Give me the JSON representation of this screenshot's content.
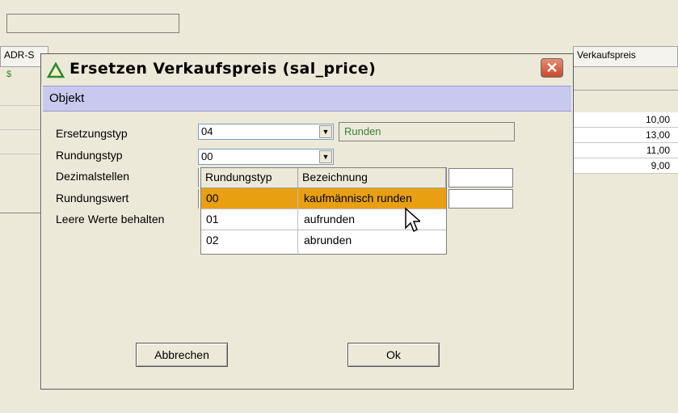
{
  "background": {
    "header_left": "ADR-S",
    "header_mid": "[]",
    "header_right": "Verkaufspreis",
    "prices": [
      "10,00",
      "13,00",
      "11,00",
      "9,00"
    ]
  },
  "dialog": {
    "title": "Ersetzen Verkaufspreis (sal_price)",
    "section": "Objekt",
    "fields": {
      "ersetzungstyp_label": "Ersetzungstyp",
      "ersetzungstyp_value": "04",
      "ersetzungstyp_desc": "Runden",
      "rundungstyp_label": "Rundungstyp",
      "rundungstyp_value": "00",
      "dezimalstellen_label": "Dezimalstellen",
      "rundungswert_label": "Rundungswert",
      "leere_label": "Leere Werte behalten"
    },
    "buttons": {
      "cancel": "Abbrechen",
      "ok": "Ok"
    },
    "dropdown": {
      "col1": "Rundungstyp",
      "col2": "Bezeichnung",
      "rows": [
        {
          "code": "00",
          "name": "kaufmännisch runden"
        },
        {
          "code": "01",
          "name": "aufrunden"
        },
        {
          "code": "02",
          "name": "abrunden"
        }
      ]
    }
  },
  "colors": {
    "selected_row": "#e8a012",
    "section_band": "#c9c9ef"
  },
  "icons": {
    "title": "triangle-logo-icon",
    "close": "close-icon",
    "cursor": "mouse-pointer-icon"
  }
}
